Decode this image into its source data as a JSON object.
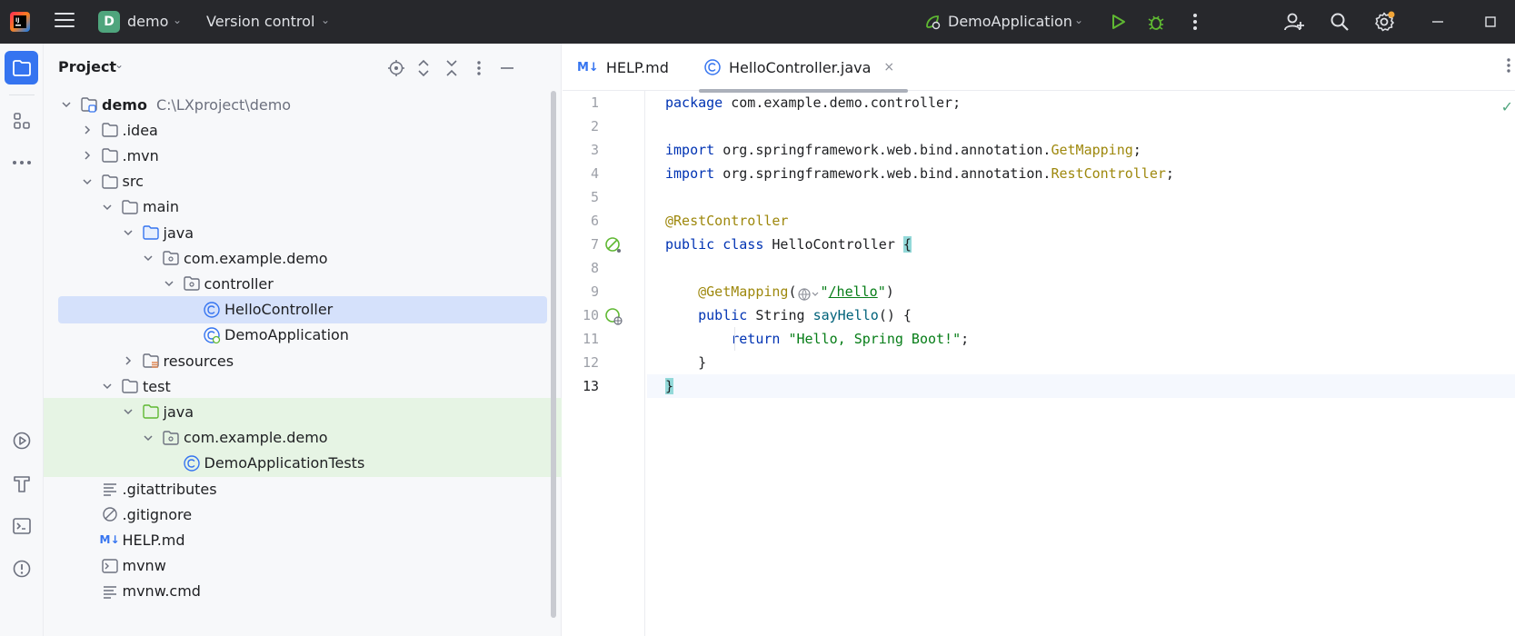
{
  "titlebar": {
    "project_initial": "D",
    "project_name": "demo",
    "vcs": "Version control",
    "run_config": "DemoApplication"
  },
  "project_panel": {
    "title": "Project",
    "tree": [
      {
        "label": "demo",
        "path": "C:\\LXproject\\demo",
        "chev": "down",
        "icon": "module-folder-icon"
      },
      {
        "label": ".idea",
        "chev": "right",
        "icon": "folder-icon"
      },
      {
        "label": ".mvn",
        "chev": "right",
        "icon": "folder-icon"
      },
      {
        "label": "src",
        "chev": "down",
        "icon": "folder-icon"
      },
      {
        "label": "main",
        "chev": "down",
        "icon": "folder-icon"
      },
      {
        "label": "java",
        "chev": "down",
        "icon": "source-folder-icon"
      },
      {
        "label": "com.example.demo",
        "chev": "down",
        "icon": "package-icon"
      },
      {
        "label": "controller",
        "chev": "down",
        "icon": "package-icon"
      },
      {
        "label": "HelloController",
        "chev": "",
        "icon": "class-icon",
        "selected": true
      },
      {
        "label": "DemoApplication",
        "chev": "",
        "icon": "spring-class-icon"
      },
      {
        "label": "resources",
        "chev": "right",
        "icon": "resources-folder-icon"
      },
      {
        "label": "test",
        "chev": "down",
        "icon": "folder-icon"
      },
      {
        "label": "java",
        "chev": "down",
        "icon": "test-folder-icon",
        "test": true
      },
      {
        "label": "com.example.demo",
        "chev": "down",
        "icon": "package-icon",
        "test": true
      },
      {
        "label": "DemoApplicationTests",
        "chev": "",
        "icon": "class-icon",
        "test": true
      },
      {
        "label": ".gitattributes",
        "chev": "",
        "icon": "text-file-icon"
      },
      {
        "label": ".gitignore",
        "chev": "",
        "icon": "ignore-file-icon"
      },
      {
        "label": "HELP.md",
        "chev": "",
        "icon": "markdown-icon"
      },
      {
        "label": "mvnw",
        "chev": "",
        "icon": "shell-file-icon"
      },
      {
        "label": "mvnw.cmd",
        "chev": "",
        "icon": "text-file-icon"
      }
    ]
  },
  "editor": {
    "tabs": [
      {
        "label": "HELP.md",
        "badge": "M↓"
      },
      {
        "label": "HelloController.java",
        "close": "×"
      }
    ],
    "line_numbers": [
      "1",
      "2",
      "3",
      "4",
      "5",
      "6",
      "7",
      "8",
      "9",
      "10",
      "11",
      "12",
      "13"
    ],
    "code": {
      "l1_kw": "package",
      "l1_rest": " com.example.demo.controller;",
      "l3_kw": "import",
      "l3_pkg": " org.springframework.web.bind.annotation.",
      "l3_cls": "GetMapping",
      "l3_end": ";",
      "l4_kw": "import",
      "l4_pkg": " org.springframework.web.bind.annotation.",
      "l4_cls": "RestController",
      "l4_end": ";",
      "l6_ann": "@RestController",
      "l7_kw": "public class",
      "l7_name": " HelloController ",
      "l7_brace": "{",
      "l9_ann": "    @GetMapping",
      "l9_open": "(",
      "l9_str_q1": "\"",
      "l9_url": "/hello",
      "l9_str_q2": "\"",
      "l9_close": ")",
      "l10_kw": "    public",
      "l10_type": " String ",
      "l10_fn": "sayHello",
      "l10_rest": "() {",
      "l11_kw": "        return",
      "l11_sp": " ",
      "l11_str": "\"Hello, Spring Boot!\"",
      "l11_end": ";",
      "l12": "    }",
      "l13_brace": "}"
    }
  }
}
